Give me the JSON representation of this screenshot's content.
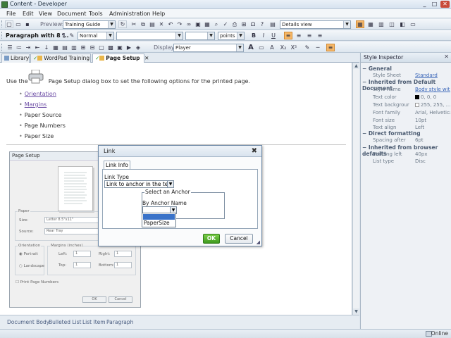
{
  "window": {
    "title": "Content - Developer",
    "min": "_",
    "max": "□",
    "close": "✕"
  },
  "menu": [
    "File",
    "Edit",
    "View",
    "Document",
    "Tools",
    "Administration",
    "Help"
  ],
  "toolbar1": {
    "preview_label": "Preview:",
    "preview_value": "Training Guide",
    "view_value": "Details view"
  },
  "toolbar2": {
    "style_label": "Paragraph with 8 ...",
    "style_value": "Normal",
    "size_unit": "points",
    "bold": "B",
    "italic": "I",
    "underline": "U"
  },
  "toolbar3": {
    "display_label": "Display:",
    "display_value": "Player",
    "big_a": "A",
    "sub": "X₂",
    "sup": "X²"
  },
  "tabs": [
    {
      "label": "Library"
    },
    {
      "label": "WordPad Training"
    },
    {
      "label": "Page Setup",
      "close": "✕"
    }
  ],
  "document": {
    "intro_pre": "Use the",
    "intro_post": "Page Setup dialog box to set the following options for the printed page.",
    "bullets": [
      {
        "text": "Orientation",
        "link": true
      },
      {
        "text": "Margins",
        "link": true
      },
      {
        "text": "Paper Source",
        "link": false
      },
      {
        "text": "Page Numbers",
        "link": false
      },
      {
        "text": "Paper Size",
        "link": false
      }
    ],
    "pagesetup_image": {
      "title": "Page Setup",
      "paper": "Paper",
      "size": "Size:",
      "size_value": "Letter 8.5\"x11\"",
      "source": "Source:",
      "source_value": "Rear Tray",
      "orientation": "Orientation",
      "portrait": "Portrait",
      "landscape": "Landscape",
      "margins": "Margins (inches)",
      "left": "Left:",
      "right": "Right:",
      "top": "Top:",
      "bottom": "Bottom:",
      "val": "1",
      "print_numbers": "Print Page Numbers",
      "ok": "OK",
      "cancel": "Cancel"
    }
  },
  "link_dialog": {
    "title": "Link",
    "close": "✖",
    "tab": "Link Info",
    "link_type_label": "Link Type",
    "link_type_value": "Link to anchor in the text",
    "anchor_group": "Select an Anchor",
    "by_anchor_label": "By Anchor Name",
    "anchor_value": "",
    "anchor_options": [
      "",
      "PaperSize"
    ],
    "ok": "OK",
    "cancel": "Cancel"
  },
  "inspector": {
    "title": "Style Inspector",
    "close": "✕",
    "sections": [
      {
        "title": "General",
        "rows": [
          {
            "key": "Style Sheet",
            "value": "Standard",
            "link": true
          }
        ]
      },
      {
        "title": "Inherited from Default Document",
        "rows": [
          {
            "key": "Style name",
            "value": "Body style with 8...",
            "link": true
          },
          {
            "key": "Text color",
            "value": "0, 0, 0"
          },
          {
            "key": "Text backgrour",
            "value": "255, 255, ..."
          },
          {
            "key": "Font family",
            "value": "Arial, Helvetica, ..."
          },
          {
            "key": "Font size",
            "value": "10pt"
          },
          {
            "key": "Text align",
            "value": "Left"
          }
        ]
      },
      {
        "title": "Direct formatting",
        "rows": [
          {
            "key": "Spacing after",
            "value": "6pt"
          }
        ]
      },
      {
        "title": "Inherited from browser defaults",
        "rows": [
          {
            "key": "Padding left",
            "value": "40px"
          },
          {
            "key": "List type",
            "value": "Disc"
          }
        ]
      }
    ]
  },
  "breadcrumbs": [
    "Document Body",
    "Bulleted List",
    "List Item",
    "Paragraph"
  ],
  "status": {
    "text": "Online"
  }
}
